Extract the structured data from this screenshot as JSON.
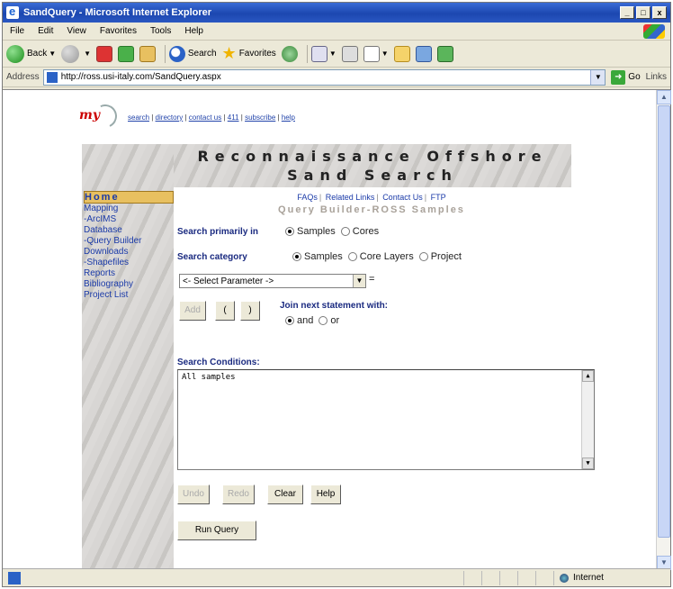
{
  "window": {
    "title": "SandQuery - Microsoft Internet Explorer",
    "controls": [
      "_",
      "□",
      "x"
    ]
  },
  "menubar": [
    "File",
    "Edit",
    "View",
    "Favorites",
    "Tools",
    "Help"
  ],
  "toolbar": {
    "back": "Back",
    "search": "Search",
    "favorites": "Favorites"
  },
  "address_bar": {
    "label": "Address",
    "url": "http://ross.usi-italy.com/SandQuery.aspx",
    "go": "Go",
    "links": "Links"
  },
  "page": {
    "top_links": [
      "search",
      "directory",
      "contact us",
      "411",
      "subscribe",
      "help"
    ],
    "header_line1": "Reconnaissance Offshore",
    "header_line2": "Sand Search",
    "nav": {
      "home": "Home",
      "items": [
        "Mapping",
        "-ArcIMS",
        "Database",
        "-Query Builder",
        "Downloads",
        "-Shapefiles",
        "Reports",
        "Bibliography",
        "Project List"
      ]
    },
    "sub_links": [
      "FAQs",
      "Related Links",
      "Contact Us",
      "FTP"
    ],
    "query_title": "Query Builder-ROSS Samples",
    "search_primarily_label": "Search primarily in",
    "primary_options": {
      "samples": "Samples",
      "cores": "Cores",
      "selected": "Samples"
    },
    "search_category_label": "Search category",
    "category_options": {
      "samples": "Samples",
      "core_layers": "Core Layers",
      "project": "Project",
      "selected": "Samples"
    },
    "parameter_select": "<- Select Parameter ->",
    "equals": "=",
    "buttons": {
      "add": "Add",
      "open_paren": "(",
      "close_paren": ")",
      "undo": "Undo",
      "redo": "Redo",
      "clear": "Clear",
      "help": "Help",
      "run": "Run Query"
    },
    "join_label": "Join next statement with:",
    "join_options": {
      "and": "and",
      "or": "or",
      "selected": "and"
    },
    "conditions_label": "Search Conditions:",
    "conditions_text": "All samples"
  },
  "statusbar": {
    "zone": "Internet"
  }
}
